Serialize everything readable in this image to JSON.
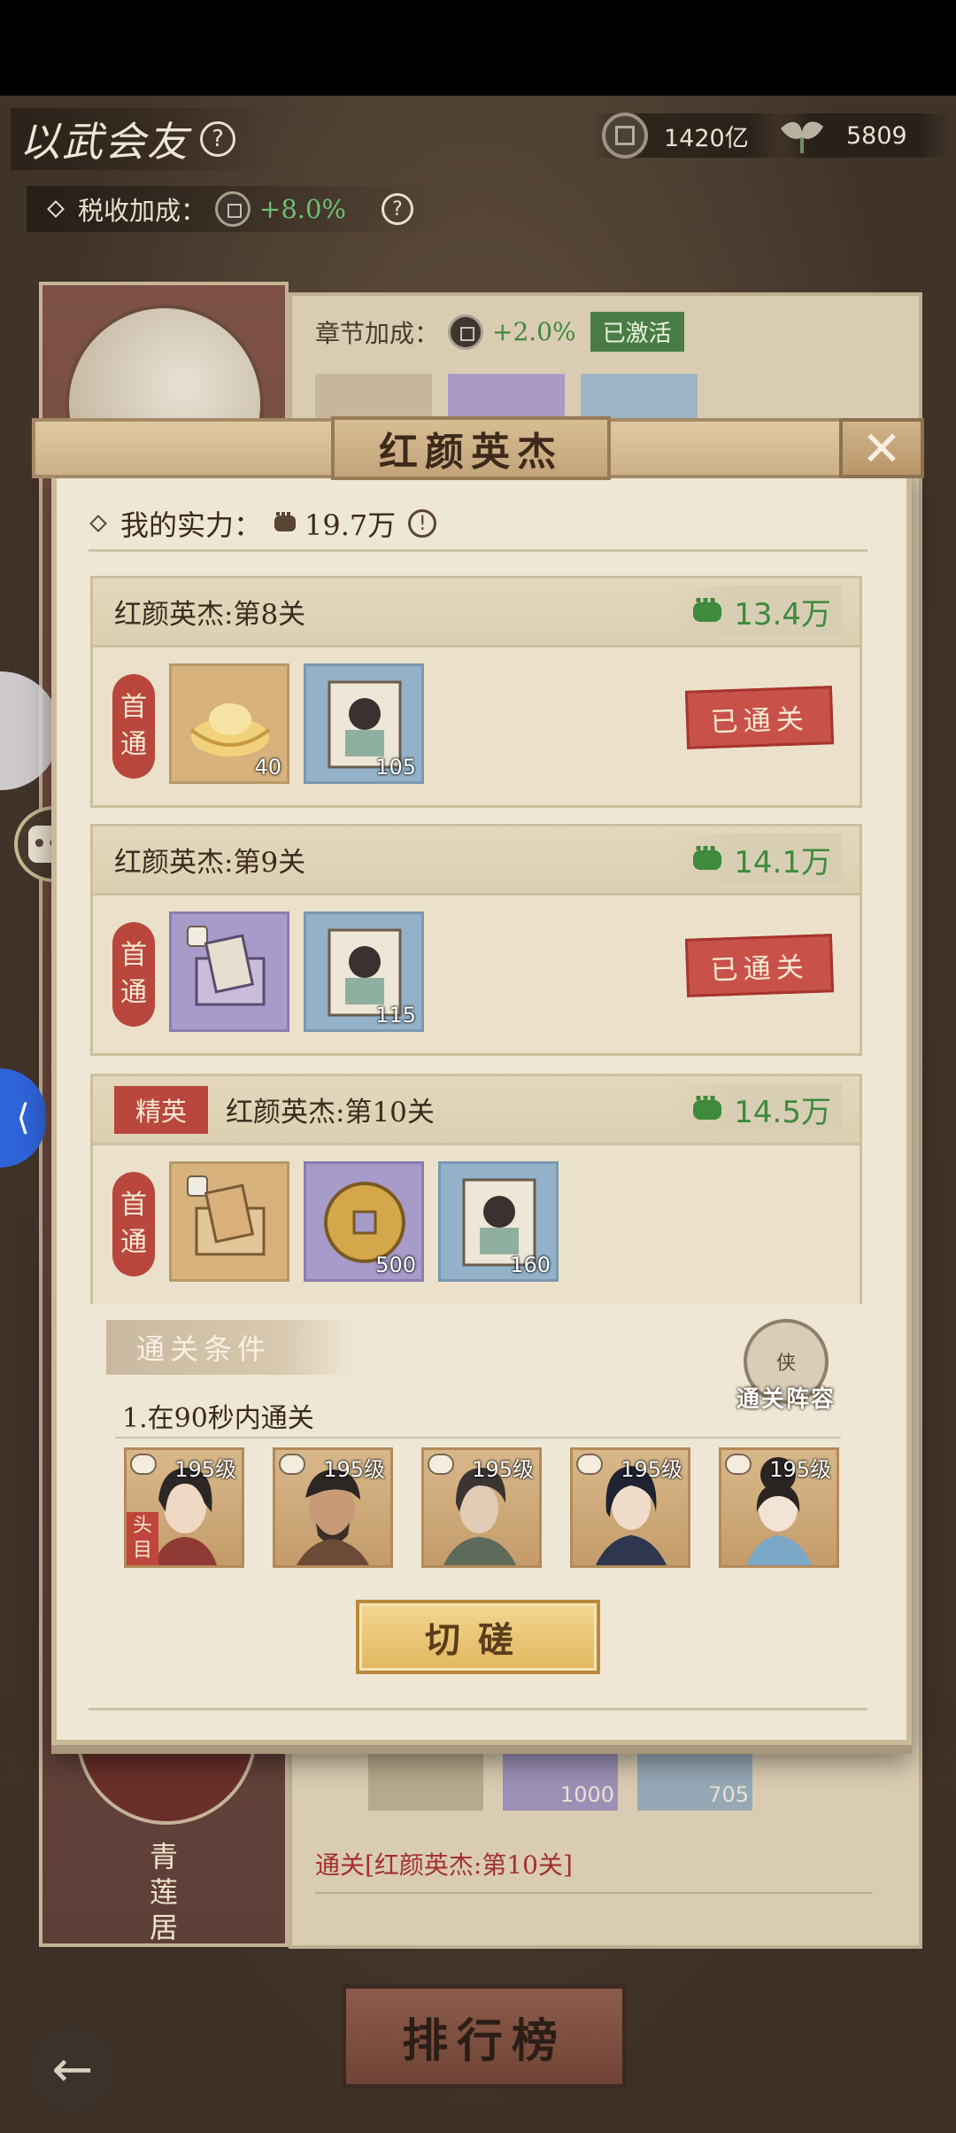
{
  "page": {
    "title": "以武会友"
  },
  "resources": {
    "coins": "1420亿",
    "leaves": "5809"
  },
  "tax": {
    "label": "税收加成：",
    "value": "+8.0%"
  },
  "background": {
    "chapter_label": "章节加成：",
    "chapter_value": "+2.0%",
    "chapter_status": "已激活",
    "bottom_item_counts": [
      "1000",
      "705"
    ],
    "pass_text": "通关[红颜英杰:第10关]",
    "place_name": "青莲居"
  },
  "modal": {
    "title": "红颜英杰",
    "close": "✕",
    "my_power_label": "我的实力：",
    "my_power_value": "19.7万",
    "stages": [
      {
        "name": "红颜英杰:第8关",
        "power": "13.4万",
        "first_clear_label": [
          "首",
          "通"
        ],
        "rewards": [
          {
            "icon": "gold-ingot-icon",
            "count": "40"
          },
          {
            "icon": "portrait-scroll-icon",
            "count": "105"
          }
        ],
        "status": "已通关"
      },
      {
        "name": "红颜英杰:第9关",
        "power": "14.1万",
        "first_clear_label": [
          "首",
          "通"
        ],
        "rewards": [
          {
            "icon": "book-box-icon",
            "count": ""
          },
          {
            "icon": "portrait-scroll-icon",
            "count": "115"
          }
        ],
        "status": "已通关"
      },
      {
        "tag": "精英",
        "name": "红颜英杰:第10关",
        "power": "14.5万",
        "first_clear_label": [
          "首",
          "通"
        ],
        "rewards": [
          {
            "icon": "book-box-icon",
            "count": ""
          },
          {
            "icon": "copper-coin-icon",
            "count": "500"
          },
          {
            "icon": "portrait-scroll-icon",
            "count": "160"
          }
        ]
      }
    ],
    "condition_title": "通关条件",
    "lineup_label": "通关阵容",
    "lineup_seal": "侠",
    "condition_text": "1.在90秒内通关",
    "enemies": [
      {
        "level": "195级",
        "boss": "头目"
      },
      {
        "level": "195级"
      },
      {
        "level": "195级"
      },
      {
        "level": "195级"
      },
      {
        "level": "195级"
      }
    ],
    "fight_button": "切磋"
  },
  "bottom": {
    "ranking": "排行榜",
    "back": "←"
  },
  "chat": {
    "badge": "...",
    "bubble": "•••"
  },
  "colors": {
    "accent_red": "#b9473d",
    "power_green": "#3f8a3c",
    "gold_button": "#e1b65f"
  }
}
